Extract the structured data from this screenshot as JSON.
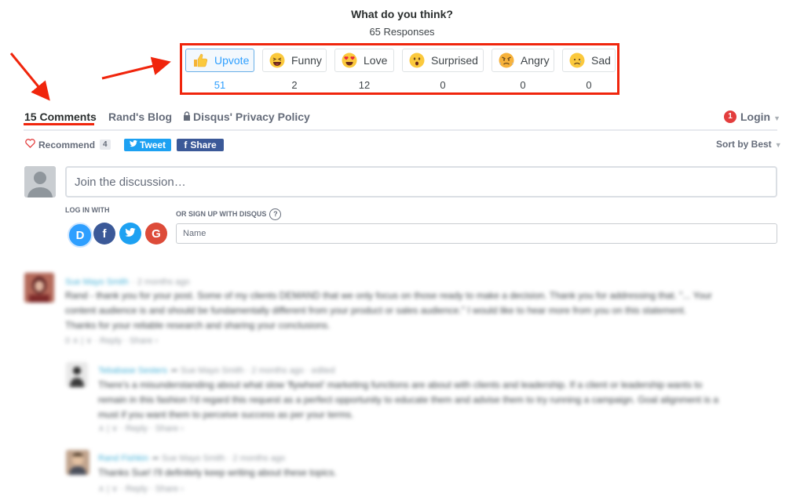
{
  "header": {
    "title": "What do you think?",
    "responses": "65 Responses"
  },
  "reactions": [
    {
      "label": "Upvote",
      "count": "51",
      "selected": true,
      "icon": "thumbs-up-icon"
    },
    {
      "label": "Funny",
      "count": "2",
      "selected": false,
      "icon": "laughing-face-icon"
    },
    {
      "label": "Love",
      "count": "12",
      "selected": false,
      "icon": "heart-eyes-face-icon"
    },
    {
      "label": "Surprised",
      "count": "0",
      "selected": false,
      "icon": "surprised-face-icon"
    },
    {
      "label": "Angry",
      "count": "0",
      "selected": false,
      "icon": "angry-face-icon"
    },
    {
      "label": "Sad",
      "count": "0",
      "selected": false,
      "icon": "sad-face-icon"
    }
  ],
  "nav": {
    "comments": "15 Comments",
    "blog": "Rand's Blog",
    "privacy": "Disqus' Privacy Policy",
    "login_badge": "1",
    "login": "Login"
  },
  "actions": {
    "recommend": "Recommend",
    "recommend_count": "4",
    "tweet": "Tweet",
    "share": "Share",
    "sort": "Sort by Best"
  },
  "compose": {
    "placeholder": "Join the discussion…",
    "login_with": "LOG IN WITH",
    "signup_with": "OR SIGN UP WITH DISQUS",
    "help": "?",
    "name_placeholder": "Name",
    "social": [
      "D",
      "f",
      "t",
      "G"
    ]
  },
  "comments": [
    {
      "author": "Sue Mayo Smith",
      "meta": "· 2 months ago",
      "lines": [
        "Rand - thank you for your post. Some of my clients DEMAND that we only focus on those ready to make a decision. Thank you for addressing that. \"... Your",
        "content audience is and should be fundamentally different from your product or sales audience.\" I would like to hear more from you on this statement.",
        "Thanks for your reliable research and sharing your conclusions."
      ],
      "actions": "0 ∧ | ∨ · Reply · Share ›"
    },
    {
      "author": "Tebabase Sesters",
      "meta": "➦ Sue Mayo Smith · 2 months ago · edited",
      "lines": [
        "There's a misunderstanding about what slow 'flywheel' marketing functions are about with clients and leadership. If a client or leadership wants to",
        "remain in this fashion I'd regard this request as a perfect opportunity to educate them and advise them to try running a campaign. Goal alignment is a",
        "must if you want them to perceive success as per your terms."
      ],
      "actions": "∧ | ∨ · Reply · Share ›"
    },
    {
      "author": "Rand Fishkin",
      "meta": "➦ Sue Mayo Smith · 2 months ago",
      "lines": [
        "Thanks Sue! I'll definitely keep writing about these topics."
      ],
      "actions": "∧ | ∨ · Reply · Share ›"
    }
  ],
  "colors": {
    "accent": "#2e9fff",
    "annotation": "#f0250c",
    "twitter": "#1da1f2",
    "facebook": "#3b5998",
    "google": "#dd4b39",
    "disqus": "#2e9fff"
  }
}
